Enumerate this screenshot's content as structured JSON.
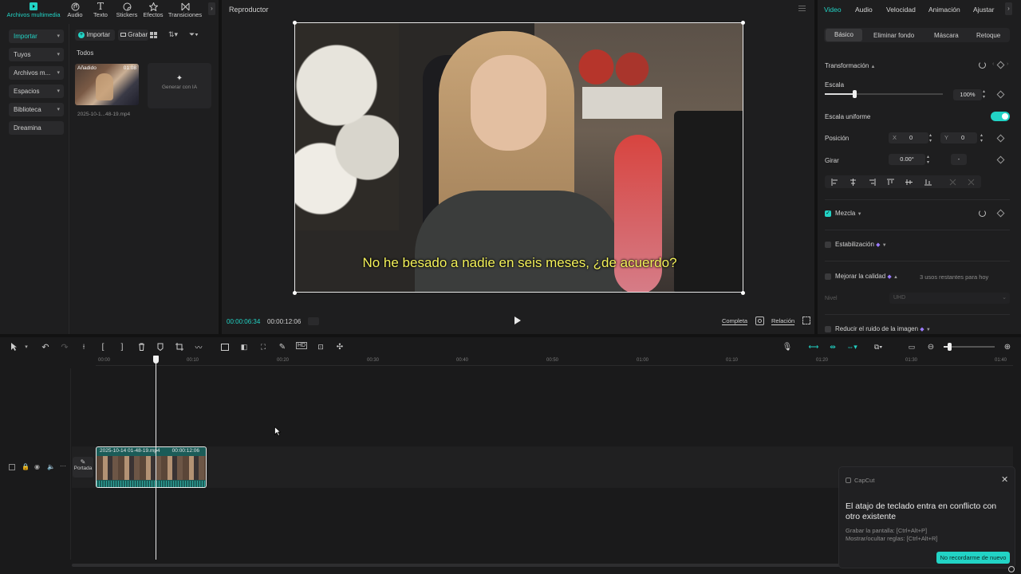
{
  "media_tabs": [
    {
      "label": "Archivos multimedia",
      "icon": "media-icon"
    },
    {
      "label": "Audio",
      "icon": "audio-icon"
    },
    {
      "label": "Texto",
      "icon": "text-icon"
    },
    {
      "label": "Stickers",
      "icon": "sticker-icon"
    },
    {
      "label": "Efectos",
      "icon": "effects-icon"
    },
    {
      "label": "Transiciones",
      "icon": "transitions-icon"
    }
  ],
  "sidebar": {
    "items": [
      {
        "label": "Importar"
      },
      {
        "label": "Tuyos"
      },
      {
        "label": "Archivos m..."
      },
      {
        "label": "Espacios"
      },
      {
        "label": "Biblioteca"
      },
      {
        "label": "Dreamina"
      }
    ]
  },
  "media": {
    "import_label": "Importar",
    "record_label": "Grabar",
    "filter_label": "Todos",
    "clip": {
      "badge": "Añadido",
      "duration": "01:08",
      "name": "2025-10-1...48-19.mp4"
    },
    "ai_label": "Generar con IA"
  },
  "player": {
    "title": "Reproductor",
    "subtitle": "No he besado a nadie en seis meses, ¿de acuerdo?",
    "current_time": "00:00:06:34",
    "total_time": "00:00:12:06",
    "full_label": "Completa",
    "ratio_label": "Relación"
  },
  "properties": {
    "tabs": [
      "Video",
      "Audio",
      "Velocidad",
      "Animación",
      "Ajustar"
    ],
    "subtabs": [
      "Básico",
      "Eliminar fondo",
      "Máscara",
      "Retoque"
    ],
    "transform_label": "Transformación",
    "scale_label": "Escala",
    "scale_value": "100%",
    "scale_fraction": 0.25,
    "uniform_label": "Escala uniforme",
    "position_label": "Posición",
    "pos_x_label": "X",
    "pos_x": "0",
    "pos_y_label": "Y",
    "pos_y": "0",
    "rotate_label": "Girar",
    "rotate_value": "0.00°",
    "rotate_dash": "-",
    "blend_label": "Mezcla",
    "stabilize_label": "Estabilización",
    "enhance_label": "Mejorar la calidad",
    "enhance_note": "3 usos restantes para hoy",
    "level_label": "Nivel",
    "level_value": "UHD",
    "denoise_label": "Reducir el ruido de la imagen"
  },
  "timeline": {
    "ruler": [
      "00:00",
      "00:10",
      "00:20",
      "00:30",
      "00:40",
      "00:50",
      "01:00",
      "01:10",
      "01:20",
      "01:30",
      "01:40"
    ],
    "cover_label": "Portada",
    "clip_name": "2025-10-14 01-48-19.mp4",
    "clip_duration": "00:00:12:06"
  },
  "toast": {
    "app": "CapCut",
    "title": "El atajo de teclado entra en conflicto con otro existente",
    "line1": "Grabar la pantalla: [Ctrl+Alt+P]",
    "line2": "Mostrar/ocultar reglas: [Ctrl+Alt+R]",
    "button": "No recordarme de nuevo"
  },
  "colors": {
    "accent": "#22d3c5",
    "background": "#121212",
    "panel": "#1e1e1f",
    "subtitle": "#f4f25a"
  }
}
